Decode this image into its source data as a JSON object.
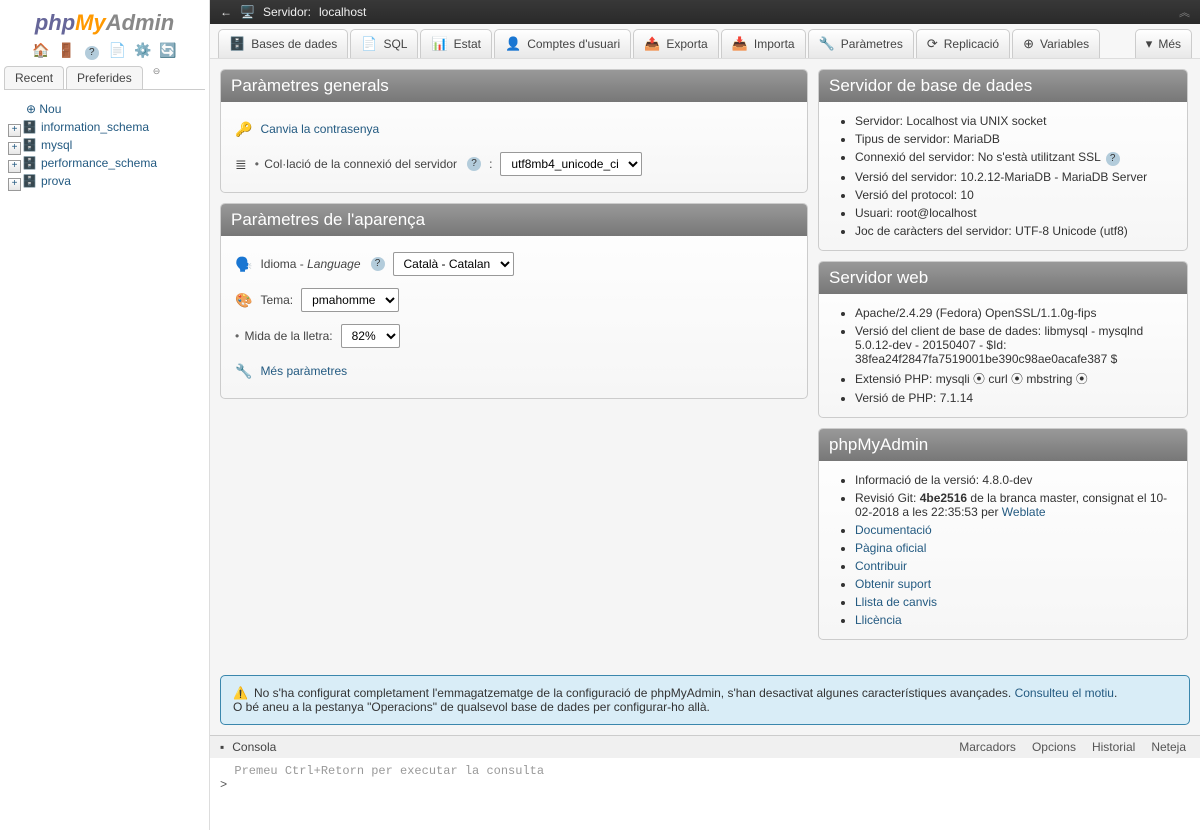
{
  "sidebar": {
    "tabs": {
      "recent": "Recent",
      "favorites": "Preferides"
    },
    "new_label": "Nou",
    "items": [
      "information_schema",
      "mysql",
      "performance_schema",
      "prova"
    ]
  },
  "topbar": {
    "server_label": "Servidor:",
    "server_name": "localhost"
  },
  "tabs": {
    "databases": "Bases de dades",
    "sql": "SQL",
    "status": "Estat",
    "users": "Comptes d'usuari",
    "export": "Exporta",
    "import": "Importa",
    "settings": "Paràmetres",
    "replication": "Replicació",
    "variables": "Variables",
    "more": "Més"
  },
  "general": {
    "title": "Paràmetres generals",
    "change_pw": "Canvia la contrasenya",
    "collation_label": "Col·lació de la connexió del servidor",
    "collation_value": "utf8mb4_unicode_ci"
  },
  "appearance": {
    "title": "Paràmetres de l'aparença",
    "lang_label": "Idioma - ",
    "lang_italic": "Language",
    "lang_value": "Català - Catalan",
    "theme_label": "Tema:",
    "theme_value": "pmahomme",
    "fontsize_label": "Mida de la lletra:",
    "fontsize_value": "82%",
    "more_link": "Més paràmetres"
  },
  "dbserver": {
    "title": "Servidor de base de dades",
    "items": [
      "Servidor: Localhost via UNIX socket",
      "Tipus de servidor: MariaDB",
      "Connexió del servidor: No s'està utilitzant SSL",
      "Versió del servidor: 10.2.12-MariaDB - MariaDB Server",
      "Versió del protocol: 10",
      "Usuari: root@localhost",
      "Joc de caràcters del servidor: UTF-8 Unicode (utf8)"
    ]
  },
  "webserver": {
    "title": "Servidor web",
    "items": [
      "Apache/2.4.29 (Fedora) OpenSSL/1.1.0g-fips",
      "Versió del client de base de dades: libmysql - mysqlnd 5.0.12-dev - 20150407 - $Id: 38fea24f2847fa7519001be390c98ae0acafe387 $",
      "Extensió PHP: mysqli ⦿ curl ⦿ mbstring ⦿",
      "Versió de PHP: 7.1.14"
    ]
  },
  "pma": {
    "title": "phpMyAdmin",
    "version": "Informació de la versió: 4.8.0-dev",
    "git_prefix": "Revisió Git: ",
    "git_hash": "4be2516",
    "git_suffix": " de la branca master, consignat el 10-02-2018 a les 22:35:53 per ",
    "git_author": "Weblate",
    "links": [
      "Documentació",
      "Pàgina oficial",
      "Contribuir",
      "Obtenir suport",
      "Llista de canvis",
      "Llicència"
    ]
  },
  "alert": {
    "line1": "No s'ha configurat completament l'emmagatzematge de la configuració de phpMyAdmin, s'han desactivat algunes característiques avançades. ",
    "link": "Consulteu el motiu",
    "line2": "O bé aneu a la pestanya \"Operacions\" de qualsevol base de dades per configurar-ho allà."
  },
  "console": {
    "label": "Consola",
    "bookmarks": "Marcadors",
    "options": "Opcions",
    "history": "Historial",
    "clear": "Neteja",
    "placeholder": "Premeu Ctrl+Retorn per executar la consulta",
    "prompt": ">"
  }
}
